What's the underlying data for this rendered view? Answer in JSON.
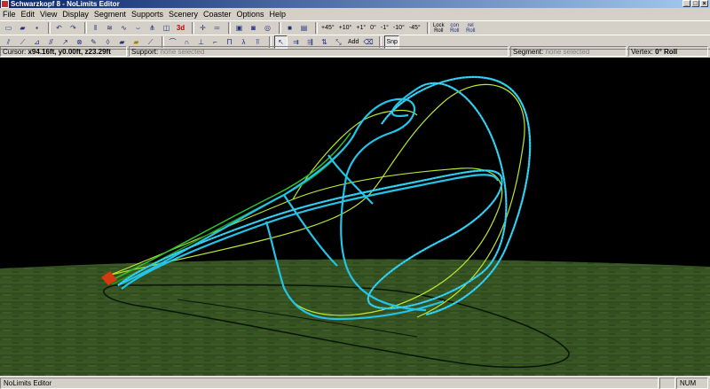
{
  "window": {
    "title": "Schwarzkopf 8 - NoLimits Editor",
    "controls": [
      "_",
      "□",
      "×"
    ]
  },
  "menu": [
    "File",
    "Edit",
    "View",
    "Display",
    "Segment",
    "Supports",
    "Scenery",
    "Coaster",
    "Options",
    "Help"
  ],
  "toolbar1": {
    "view3d_label": "3d",
    "angle_labels": [
      "+45°",
      "+10°",
      "+1°",
      "0°",
      "-1°",
      "-10°",
      "-45°"
    ],
    "lock_roll": "Lock Roll",
    "con_roll": "con Roll",
    "rel_roll": "rel Roll"
  },
  "toolbar2": {
    "add_label": "Add",
    "snap_label": "Snp"
  },
  "info": {
    "cursor_label": "Cursor:",
    "cursor_value": "x94.16ft, y0.00ft, z23.29ft",
    "support_label": "Support:",
    "support_value": "none selected",
    "segment_label": "Segment:",
    "segment_value": "none selected",
    "vertex_label": "Vertex:",
    "vertex_value": "0° Roll"
  },
  "statusbar": {
    "text": "NoLimits Editor",
    "num": "NUM"
  },
  "colors": {
    "track": "#22c4e8",
    "selected": "#b8e830",
    "chain": "#30c030",
    "ground": "#2f4f1c",
    "sky": "#000000"
  }
}
